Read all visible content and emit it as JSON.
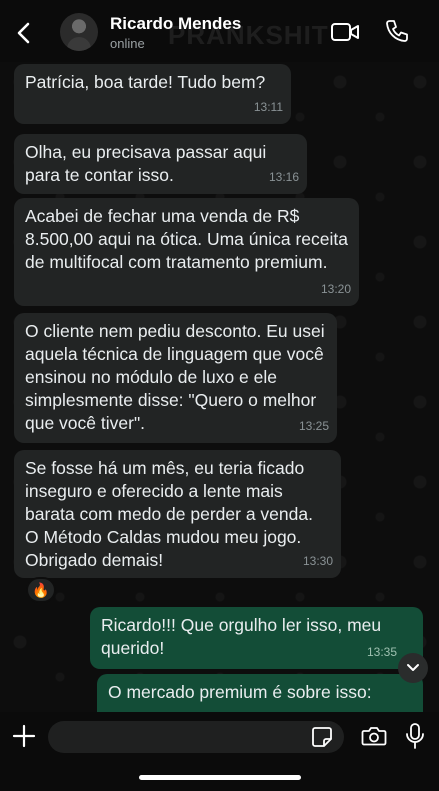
{
  "header": {
    "contact_name": "Ricardo Mendes",
    "status": "online",
    "watermark": "PRANKSHIT",
    "icons": {
      "back": "chevron-left-icon",
      "video": "video-camera-icon",
      "call": "phone-icon"
    }
  },
  "messages": [
    {
      "direction": "incoming",
      "text": "Patrícia, boa tarde! Tudo bem?",
      "time": "13:11"
    },
    {
      "direction": "incoming",
      "text": "Olha, eu precisava passar aqui para te contar isso.",
      "time": "13:16"
    },
    {
      "direction": "incoming",
      "text": "Acabei de fechar uma venda de R$ 8.500,00 aqui na ótica. Uma única receita de multifocal com tratamento premium.",
      "time": "13:20"
    },
    {
      "direction": "incoming",
      "text": "O cliente nem pediu desconto. Eu usei aquela técnica de linguagem que você ensinou no módulo de luxo e ele simplesmente disse: \"Quero o melhor que você tiver\".",
      "time": "13:25"
    },
    {
      "direction": "incoming",
      "text": "Se fosse há um mês, eu teria ficado inseguro e oferecido a lente mais barata com medo de perder a venda. O Método Caldas mudou meu jogo. Obrigado demais!",
      "time": "13:30"
    },
    {
      "direction": "outgoing",
      "text": "Ricardo!!! Que orgulho ler isso, meu querido!",
      "time": "13:35"
    },
    {
      "direction": "outgoing",
      "text": "O mercado premium é sobre isso:",
      "time": ""
    }
  ],
  "reaction": {
    "emoji": "🔥"
  },
  "input": {
    "value": "",
    "placeholder": ""
  },
  "colors": {
    "incoming_bubble": "#222424",
    "outgoing_bubble": "#134d37",
    "background": "#0b0b0b"
  }
}
